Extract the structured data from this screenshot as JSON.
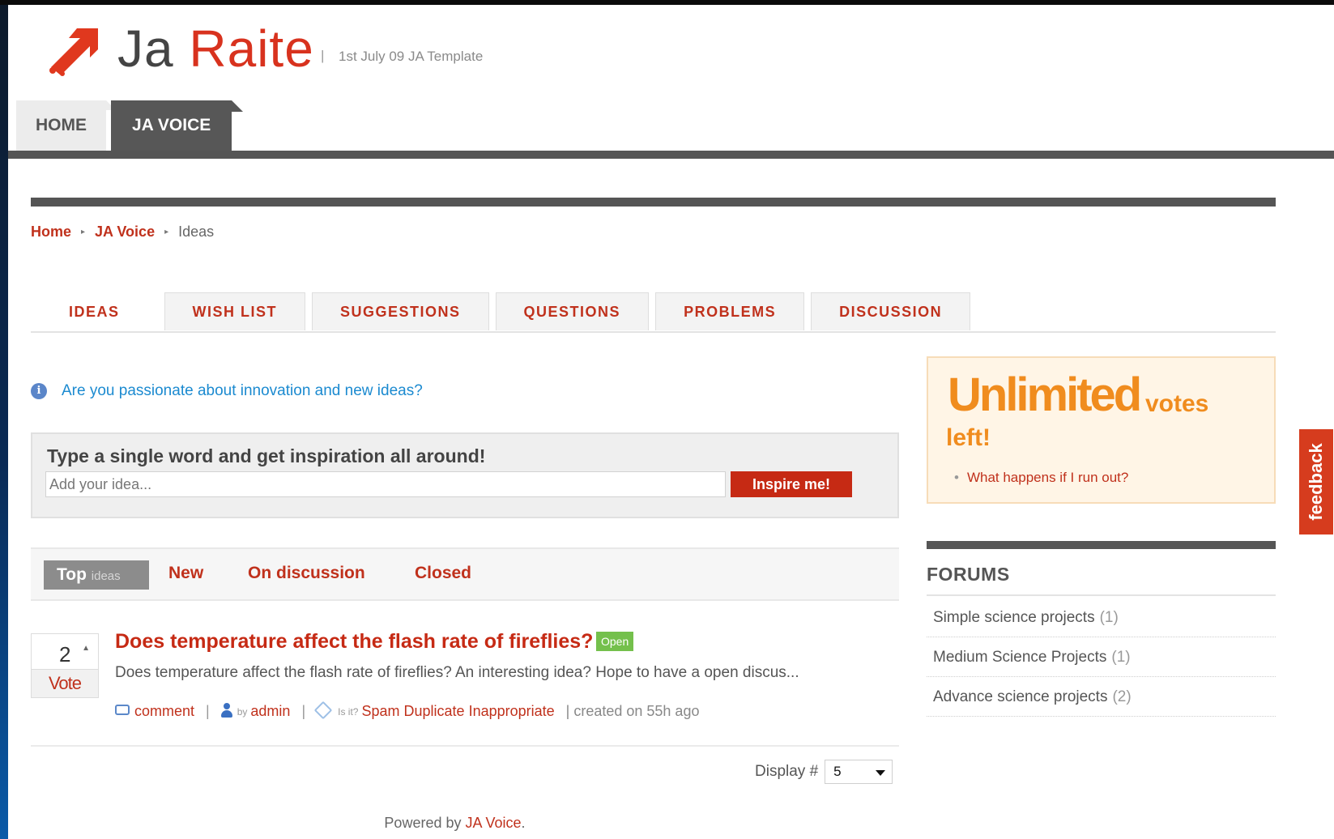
{
  "site": {
    "logo_part1": "Ja ",
    "logo_part2": "Raite",
    "separator": "|",
    "tagline": "1st July 09 JA Template"
  },
  "topnav": [
    "HOME",
    "JA VOICE"
  ],
  "breadcrumb": {
    "home": "Home",
    "section": "JA Voice",
    "current": "Ideas"
  },
  "category_tabs": [
    "IDEAS",
    "WISH LIST",
    "SUGGESTIONS",
    "QUESTIONS",
    "PROBLEMS",
    "DISCUSSION"
  ],
  "info": {
    "icon": "info-icon",
    "text": "Are you passionate about innovation and new ideas?"
  },
  "inspire": {
    "title": "Type a single word and get inspiration all around!",
    "placeholder": "Add your idea...",
    "button": "Inspire me!"
  },
  "filters": {
    "top": "Top",
    "top_sub": "ideas",
    "new": "New",
    "discussion": "On discussion",
    "closed": "Closed"
  },
  "idea": {
    "votes": "2",
    "vote_label": "Vote",
    "title": "Does temperature affect the flash rate of fireflies?",
    "status": "Open",
    "description": "Does temperature affect the flash rate of fireflies? An interesting idea? Hope to have a open discus...",
    "comment": "comment",
    "by": "by",
    "author": "admin",
    "is_it": "Is it?",
    "spam": "Spam",
    "duplicate": "Duplicate",
    "inappropriate": "Inappropriate",
    "created": "| created on 55h ago"
  },
  "display": {
    "label": "Display #",
    "value": "5"
  },
  "footer": {
    "prefix": "Powered by",
    "link": "JA Voice",
    "suffix": "."
  },
  "votes_box": {
    "big": "Unlimited",
    "small": "votes",
    "left": "left!",
    "link": "What happens if I run out?"
  },
  "forums": {
    "title": "FORUMS",
    "items": [
      {
        "name": "Simple science projects",
        "count": "(1)"
      },
      {
        "name": "Medium Science Projects",
        "count": "(1)"
      },
      {
        "name": "Advance science projects",
        "count": "(2)"
      }
    ]
  },
  "feedback": "feedback",
  "colors": {
    "brand_red": "#c62a14",
    "accent_orange": "#f08c1e",
    "status_green": "#74c04c",
    "link_blue": "#1b8ad0",
    "dark_bar": "#555555"
  }
}
